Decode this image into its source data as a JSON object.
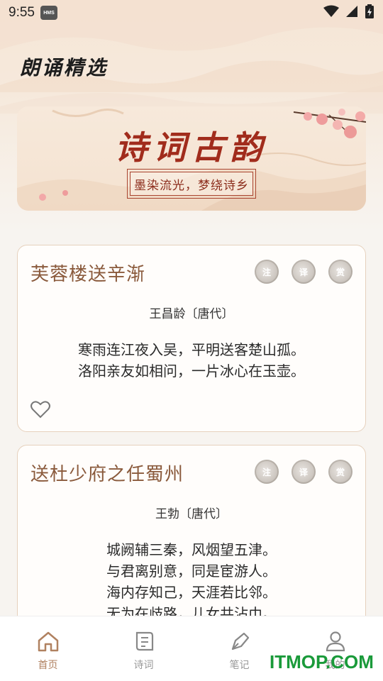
{
  "status_bar": {
    "time": "9:55",
    "hms_badge": "HMS"
  },
  "header": {
    "title": "朗诵精选"
  },
  "banner": {
    "title": "诗词古韵",
    "subtitle": "墨染流光，梦绕诗乡"
  },
  "poems": [
    {
      "title": "芙蓉楼送辛渐",
      "author": "王昌龄〔唐代〕",
      "lines": [
        "寒雨连江夜入吴，平明送客楚山孤。",
        "洛阳亲友如相问，一片冰心在玉壶。"
      ]
    },
    {
      "title": "送杜少府之任蜀州",
      "author": "王勃〔唐代〕",
      "lines": [
        "城阙辅三秦，风烟望五津。",
        "与君离别意，同是宦游人。",
        "海内存知己，天涯若比邻。",
        "无为在歧路，儿女共沾巾。"
      ]
    }
  ],
  "card_actions": {
    "annotate": "注",
    "translate": "译",
    "appreciate": "赏"
  },
  "tabs": [
    {
      "label": "首页",
      "icon": "home-icon",
      "active": true
    },
    {
      "label": "诗词",
      "icon": "scroll-icon",
      "active": false
    },
    {
      "label": "笔记",
      "icon": "pen-icon",
      "active": false
    },
    {
      "label": "我的",
      "icon": "user-icon",
      "active": false
    }
  ],
  "watermark": "ITMOP.COM",
  "colors": {
    "accent": "#b08160",
    "banner_red": "#a12c1c",
    "card_title": "#8a5a3c",
    "watermark_green": "#1a9a3a"
  }
}
